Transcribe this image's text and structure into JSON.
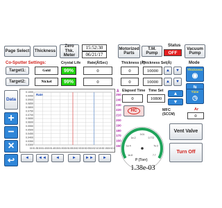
{
  "topbar": {
    "page_select": "Page Select",
    "thickness": "Thickness",
    "zero_thk_meter": "Zero Thk. Meter",
    "time": "15:52:30",
    "date": "06/21/17",
    "motorized_parts": "Motorized Parts",
    "tm_pump": "T.M. Pump",
    "status_label": "Status",
    "status_value": "OFF",
    "vacuum_pump": "Vacuum Pump"
  },
  "settings": {
    "title": "Co-Sputter Settings:",
    "col_crystal_life": "Crystal Life",
    "col_rate": "Rate(Å/Sec)",
    "col_thickness": "Thickness (Å)",
    "col_thickness_set": "Thickness Set(Å)",
    "mode_label": "Mode",
    "mode_button": "Thickness",
    "targets": [
      {
        "label": "Target1:",
        "material": "Gold",
        "crystal": "99%",
        "rate": "0",
        "thickness": "0",
        "thickness_set": "10000"
      },
      {
        "label": "Target2:",
        "material": "Nickel",
        "crystal": "99%",
        "rate": "0",
        "thickness": "0",
        "thickness_set": "10000"
      }
    ]
  },
  "sidebar": {
    "data_label": "Data",
    "plus": "+",
    "minus": "−",
    "x": "×",
    "back": "↩"
  },
  "chart_data": {
    "type": "line",
    "title": "Rate",
    "xlabel": "",
    "ylabel": "",
    "y_ticks": [
      "0.1000",
      "0.0950",
      "0.0900",
      "0.0850",
      "0.0800",
      "0.0750",
      "0.0700",
      "0.0650",
      "0.0600",
      "0.0550",
      "0.0500",
      "0.0450",
      "0.0400",
      "0.0350",
      "0.0300"
    ],
    "y2_ticks": [
      "250",
      "240",
      "230",
      "220",
      "210",
      "200",
      "190",
      "180",
      "170",
      "160",
      "150"
    ],
    "y2_unit": "Å",
    "x_ticks": [
      "15:51:35",
      "15:51:40",
      "15:51:45",
      "15:51:50",
      "15:51:55",
      "15:52:00",
      "15:52:05",
      "15:52:10",
      "15:52:15",
      "15:52:20"
    ],
    "series": []
  },
  "chart_nav": {
    "first": "◄",
    "rew": "◄◄",
    "prev": "◄",
    "next": "►",
    "ff": "►►",
    "last": "►"
  },
  "timing": {
    "elapsed_label": "Elapsed Time",
    "elapsed_value": "0",
    "timeset_label": "Time Set",
    "timeset_value": "10800",
    "time_button": "Time",
    "hc_label": "HC",
    "mfc_label": "MFC",
    "mfc_unit": "(SCCM)",
    "ar_label": "Ar",
    "ar_value": "0"
  },
  "gauge": {
    "label": "P (Torr)",
    "value": "1.38e-03",
    "ticks": [
      "1e-8",
      "1e-4",
      "1e-2",
      "0.01",
      "0.772",
      "7e-2",
      "7.7"
    ]
  },
  "right_panel": {
    "vent_valve": "Vent Valve",
    "turn_off": "Turn Off"
  }
}
